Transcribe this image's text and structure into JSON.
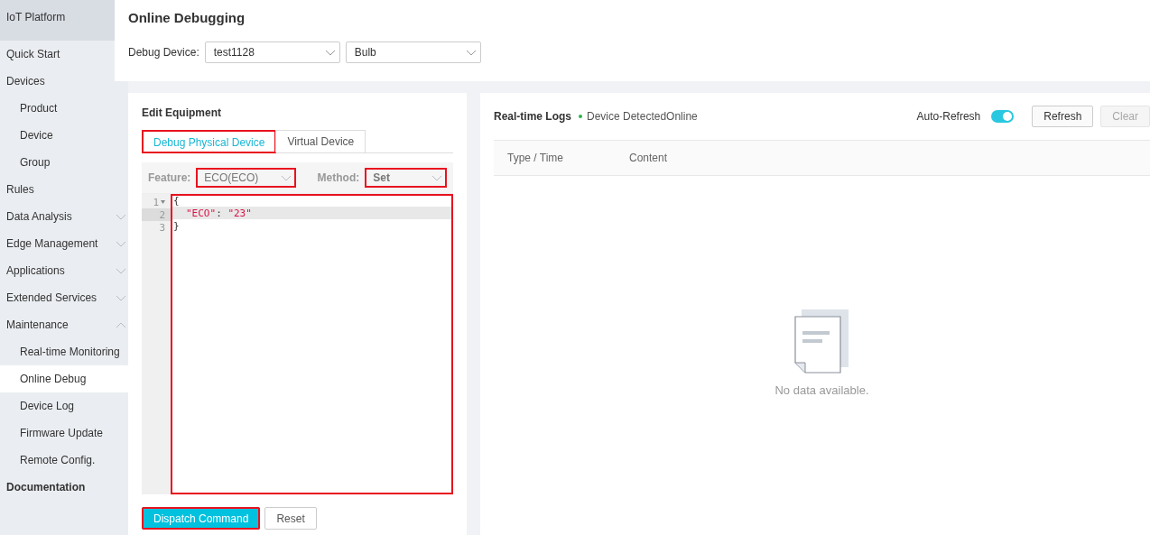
{
  "brand": "IoT Platform",
  "sidebar": {
    "items": [
      {
        "label": "Quick Start",
        "kind": "link",
        "selected": false
      },
      {
        "label": "Devices",
        "kind": "link",
        "selected": false,
        "children": [
          {
            "label": "Product",
            "selected": false
          },
          {
            "label": "Device",
            "selected": false
          },
          {
            "label": "Group",
            "selected": false
          }
        ]
      },
      {
        "label": "Rules",
        "kind": "link",
        "selected": false
      },
      {
        "label": "Data Analysis",
        "kind": "link",
        "selected": false,
        "expanded": false
      },
      {
        "label": "Edge Management",
        "kind": "link",
        "selected": false,
        "expanded": false
      },
      {
        "label": "Applications",
        "kind": "link",
        "selected": false,
        "expanded": false
      },
      {
        "label": "Extended Services",
        "kind": "link",
        "selected": false,
        "expanded": false
      },
      {
        "label": "Maintenance",
        "kind": "link",
        "selected": false,
        "expanded": true,
        "children": [
          {
            "label": "Real-time Monitoring",
            "selected": false
          },
          {
            "label": "Online Debug",
            "selected": true
          },
          {
            "label": "Device Log",
            "selected": false
          },
          {
            "label": "Firmware Update",
            "selected": false
          },
          {
            "label": "Remote Config.",
            "selected": false
          }
        ]
      },
      {
        "label": "Documentation",
        "kind": "section",
        "selected": false
      }
    ]
  },
  "header": {
    "title": "Online Debugging",
    "device_label": "Debug Device:",
    "device_selects": [
      "test1128",
      "Bulb"
    ]
  },
  "edit_panel": {
    "title": "Edit Equipment",
    "tabs": [
      {
        "label": "Debug Physical Device",
        "selected": true,
        "highlighted": true
      },
      {
        "label": "Virtual Device",
        "selected": false,
        "highlighted": false
      }
    ],
    "feature": {
      "label": "Feature:",
      "value": "ECO(ECO)",
      "highlighted": true
    },
    "method": {
      "label": "Method:",
      "value": "Set",
      "highlighted": true
    },
    "editor": {
      "highlighted": true,
      "lines": [
        {
          "number": "1",
          "foldable": true,
          "active": false,
          "indented": false,
          "tokens": [
            {
              "text": "{",
              "kind": "punct"
            }
          ]
        },
        {
          "number": "2",
          "foldable": false,
          "active": true,
          "indented": true,
          "tokens": [
            {
              "text": "\"ECO\"",
              "kind": "string"
            },
            {
              "text": ": ",
              "kind": "punct"
            },
            {
              "text": "\"23\"",
              "kind": "string"
            }
          ]
        },
        {
          "number": "3",
          "foldable": false,
          "active": false,
          "indented": false,
          "tokens": [
            {
              "text": "}",
              "kind": "punct"
            }
          ]
        }
      ]
    },
    "buttons": [
      {
        "label": "Dispatch Command",
        "kind": "primary",
        "highlighted": true
      },
      {
        "label": "Reset",
        "kind": "default",
        "highlighted": false
      }
    ]
  },
  "logs_panel": {
    "title": "Real-time Logs",
    "status": {
      "text": "Device DetectedOnline",
      "color": "#2bb34a"
    },
    "auto_refresh": {
      "label": "Auto-Refresh",
      "on": true
    },
    "buttons": [
      {
        "label": "Refresh",
        "disabled": false
      },
      {
        "label": "Clear",
        "disabled": true
      }
    ],
    "columns": [
      "Type / Time",
      "Content"
    ],
    "empty_text": "No data available."
  }
}
